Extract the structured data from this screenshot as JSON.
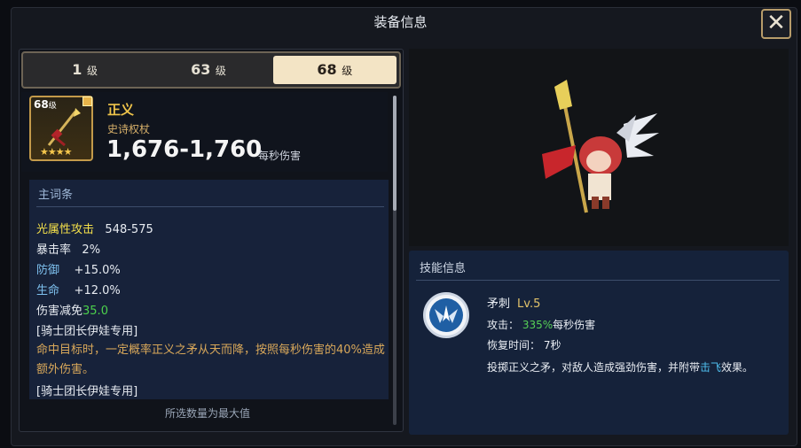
{
  "window": {
    "title": "装备信息",
    "close_glyph": "✕"
  },
  "tabs": [
    {
      "value": "1",
      "unit": "级",
      "active": false
    },
    {
      "value": "63",
      "unit": "级",
      "active": false
    },
    {
      "value": "68",
      "unit": "级",
      "active": true
    }
  ],
  "item": {
    "level": "68",
    "level_unit": "级",
    "stars": "★★★★",
    "name": "正义",
    "type": "史诗权杖",
    "damage": "1,676-1,760",
    "damage_unit": "每秒伤害"
  },
  "stats": {
    "title": "主词条",
    "rows": [
      {
        "key": "光属性攻击",
        "value": "548-575"
      },
      {
        "key": "暴击率",
        "value": "2%"
      },
      {
        "key": "防御",
        "value": "+15.0%"
      },
      {
        "key": "生命",
        "value": "+12.0%"
      },
      {
        "key": "伤害减免",
        "value": "35.0"
      }
    ],
    "exclusive_1": "[骑士团长伊娃专用]",
    "desc": "命中目标时，一定概率正义之矛从天而降，按照每秒伤害的40%造成额外伤害。",
    "exclusive_2": "[骑士团长伊娃专用]"
  },
  "footer": "所选数量为最大值",
  "skill": {
    "section_title": "技能信息",
    "name": "矛刺",
    "level": "Lv.5",
    "attack_label": "攻击：",
    "attack_pct": "335%",
    "attack_unit": "每秒伤害",
    "cooldown_label": "恢复时间：",
    "cooldown_value": "7秒",
    "desc_prefix": "投掷正义之矛，对敌人造成强劲伤害，并附带",
    "desc_highlight": "击飞",
    "desc_suffix": "效果。"
  },
  "icons": [
    "close-icon",
    "weapon-icon",
    "skill-wings-icon",
    "character-sprite"
  ]
}
